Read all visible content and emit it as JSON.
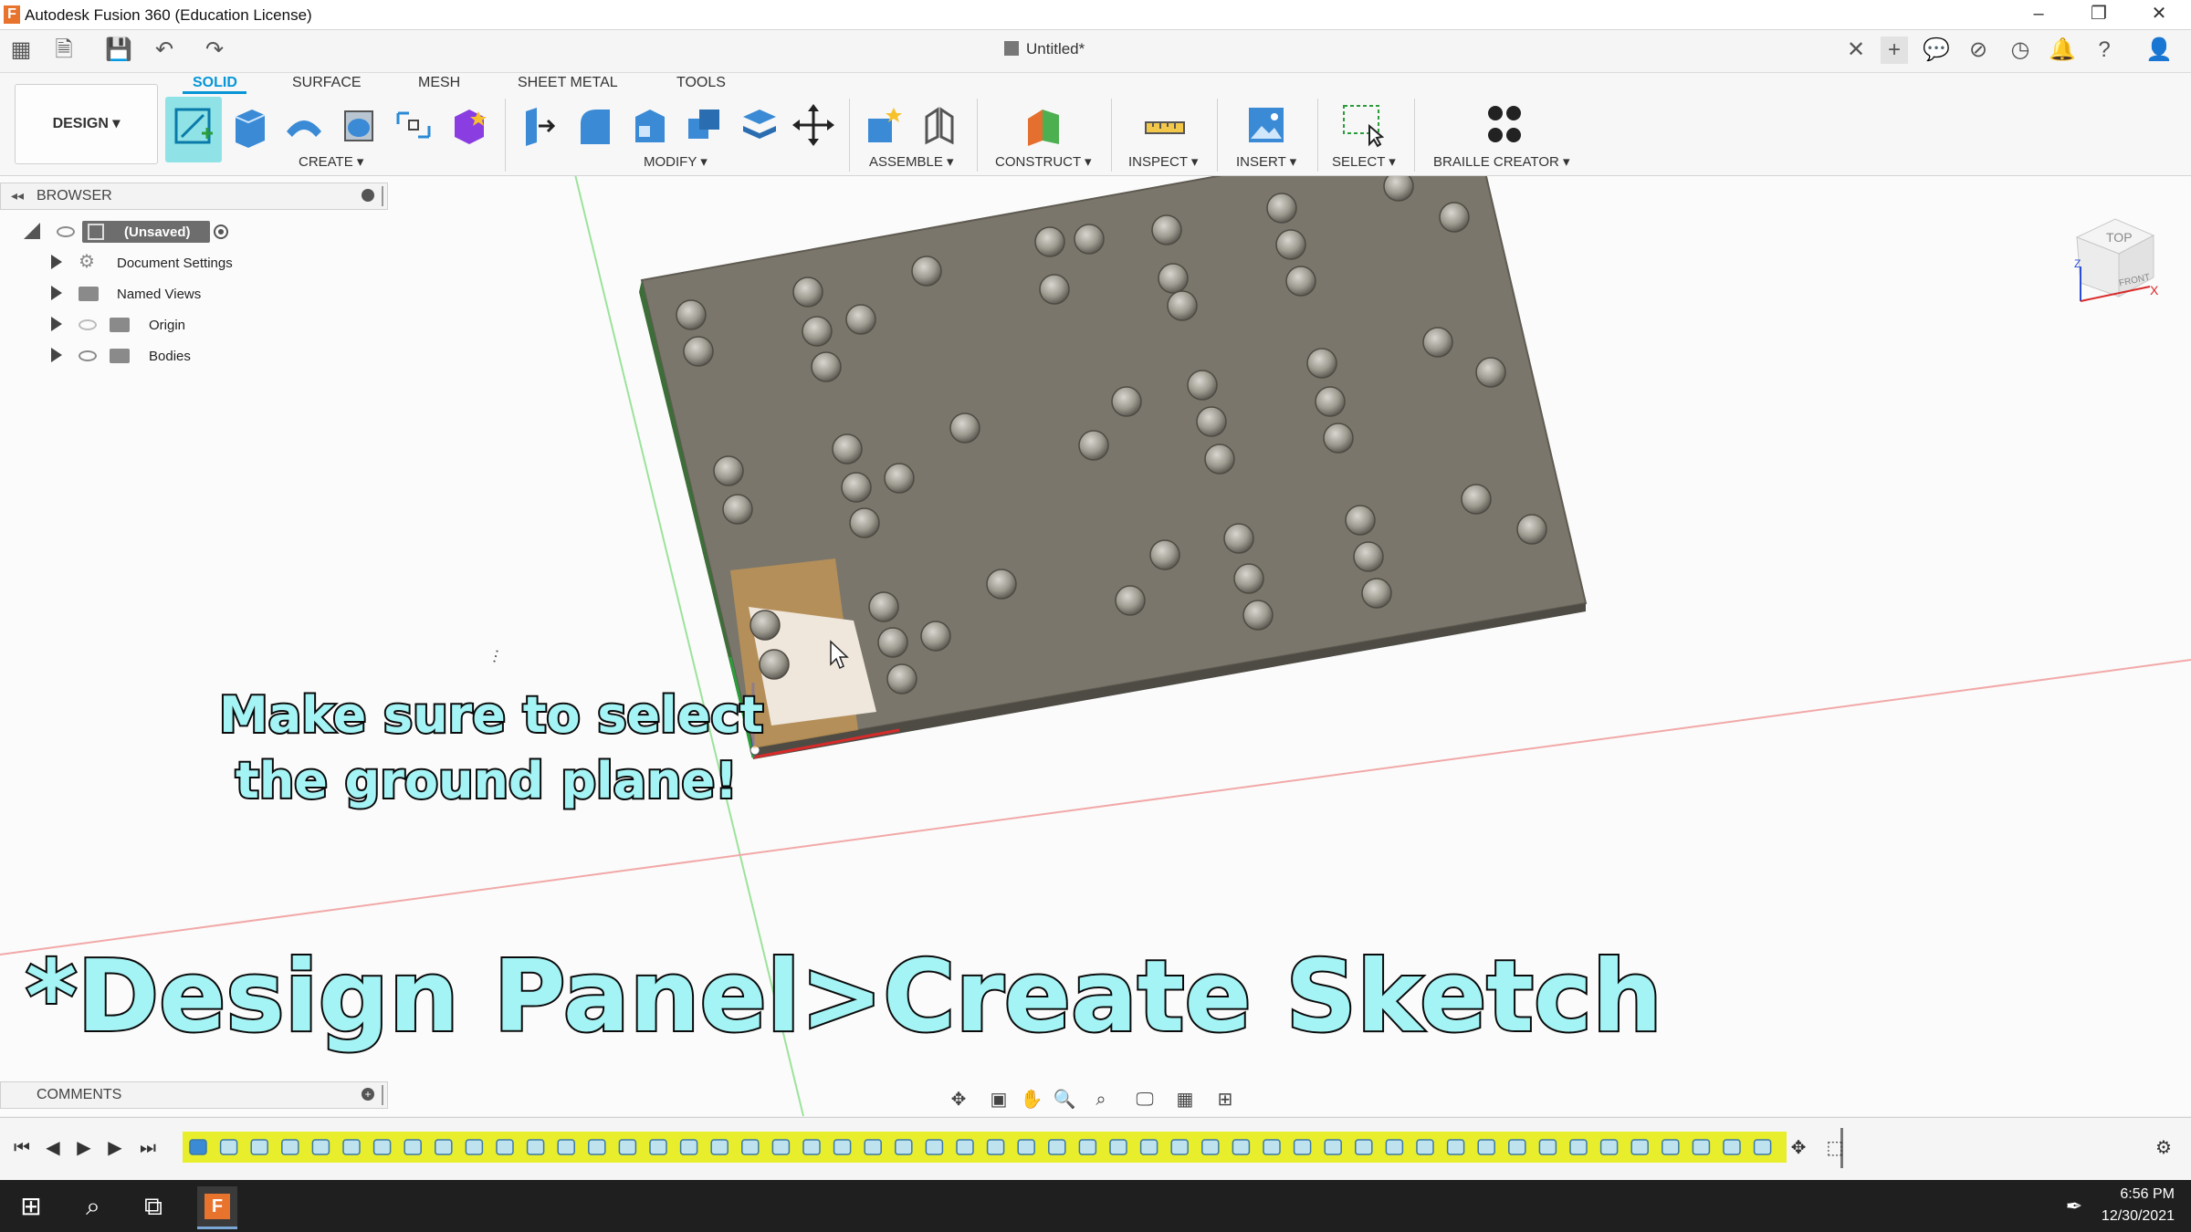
{
  "window": {
    "title": "Autodesk Fusion 360 (Education License)",
    "logo_letter": "F",
    "minimize": "–",
    "maximize": "❐",
    "close": "✕"
  },
  "document": {
    "tab_title": "Untitled*",
    "close_tab": "✕",
    "add_tab": "+"
  },
  "ribbon": {
    "workspace": "DESIGN ▾",
    "tabs": [
      "SOLID",
      "SURFACE",
      "MESH",
      "SHEET METAL",
      "TOOLS"
    ],
    "groups": [
      "CREATE ▾",
      "MODIFY ▾",
      "ASSEMBLE ▾",
      "CONSTRUCT ▾",
      "INSPECT ▾",
      "INSERT ▾",
      "SELECT ▾",
      "BRAILLE CREATOR ▾"
    ]
  },
  "browser": {
    "title": "BROWSER",
    "root": "(Unsaved)",
    "nodes": [
      "Document Settings",
      "Named Views",
      "Origin",
      "Bodies"
    ]
  },
  "viewcube": {
    "top": "TOP",
    "front": "FRONT",
    "axis_z": "Z",
    "axis_x": "X"
  },
  "captions": {
    "line1": "Make sure to select",
    "line2": "the ground plane!",
    "main": "*Design Panel>Create Sketch"
  },
  "comments": {
    "label": "COMMENTS"
  },
  "taskbar": {
    "time": "6:56 PM",
    "date": "12/30/2021"
  },
  "colors": {
    "accent": "#0696d7",
    "plate": "#7a766b",
    "caption_fill": "#a4f3f5",
    "timeline": "#e8ee2c"
  }
}
